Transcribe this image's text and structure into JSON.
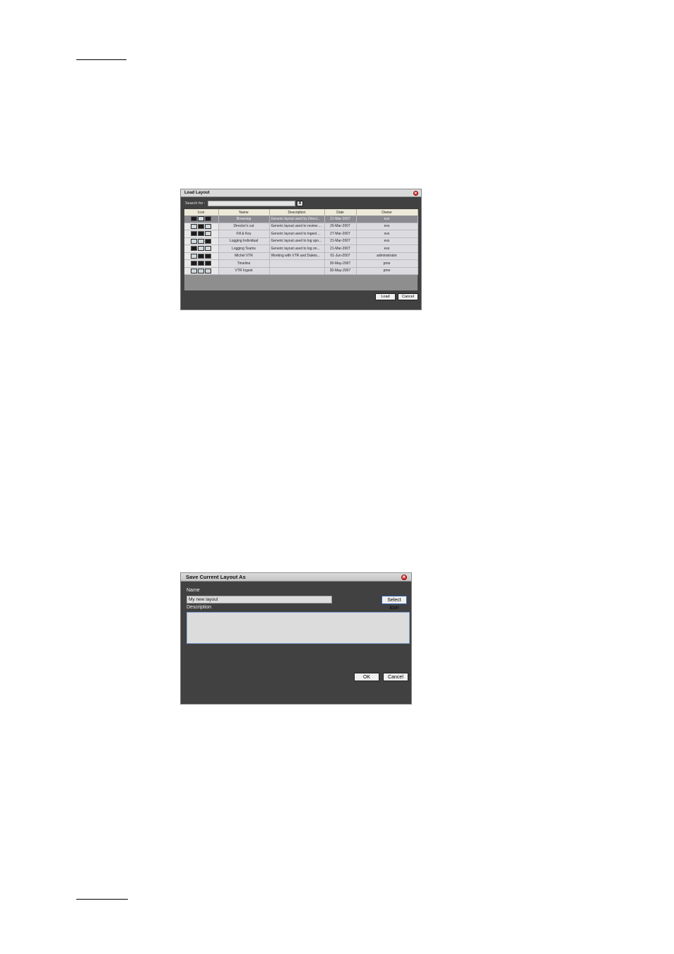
{
  "load_layout": {
    "title": "Load Layout",
    "search_label": "Search for :",
    "search_value": "",
    "clear_label": "X",
    "columns": [
      "Icon",
      "Name",
      "Description",
      "Date",
      "Owner"
    ],
    "rows": [
      {
        "name": "Browsing",
        "description": "Generic layout used by Direct...",
        "date": "21-Mar-2007",
        "owner": "evs",
        "selected": true
      },
      {
        "name": "Director's cut",
        "description": "Generic layout used to review ...",
        "date": "26-Mar-2007",
        "owner": "evs"
      },
      {
        "name": "Fill & Key",
        "description": "Generic layout used to ingest ...",
        "date": "27-Mar-2007",
        "owner": "evs"
      },
      {
        "name": "Logging Individual",
        "description": "Generic layout used to log spo...",
        "date": "21-Mar-2007",
        "owner": "evs"
      },
      {
        "name": "Logging Teams",
        "description": "Generic layout used to log on...",
        "date": "21-Mar-2007",
        "owner": "evs"
      },
      {
        "name": "Michel VTR",
        "description": "Working with VTR and Dalets...",
        "date": "01-Jun-2007",
        "owner": "administrator"
      },
      {
        "name": "Timeline",
        "description": "",
        "date": "30-May-2007",
        "owner": "pme"
      },
      {
        "name": "VTR Ingest",
        "description": "",
        "date": "30-May-2007",
        "owner": "pme"
      }
    ],
    "load_label": "Load",
    "cancel_label": "Cancel"
  },
  "save_layout": {
    "title": "Save Current Layout As",
    "name_label": "Name",
    "name_value": "My new layout",
    "description_label": "Description",
    "description_value": "",
    "select_icon_label": "Select icon",
    "ok_label": "OK",
    "cancel_label": "Cancel"
  }
}
